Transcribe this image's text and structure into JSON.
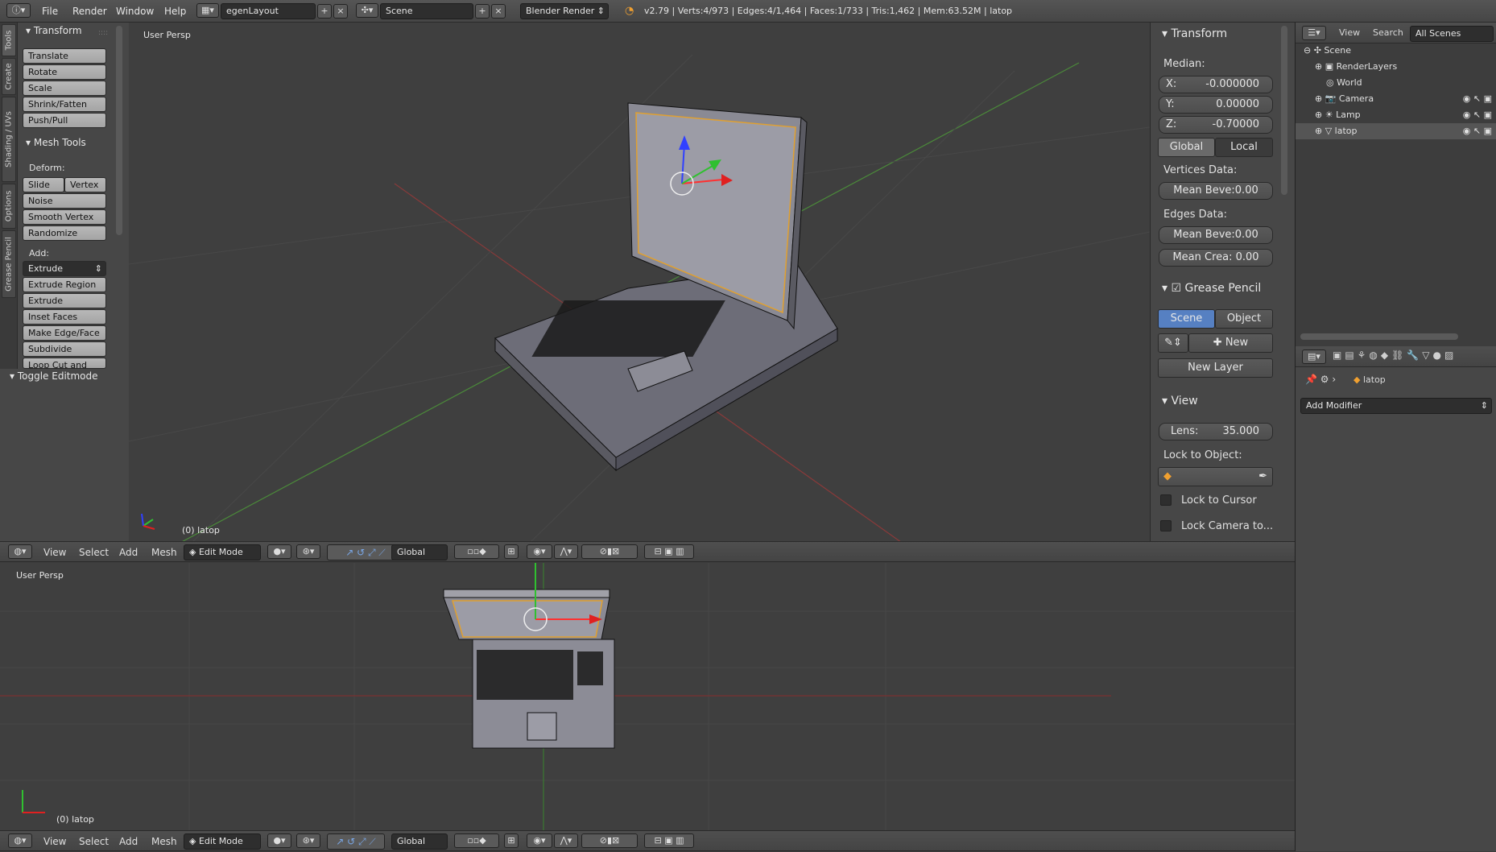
{
  "topbar": {
    "menus": [
      "File",
      "Render",
      "Window",
      "Help"
    ],
    "layout": "egenLayout",
    "scene": "Scene",
    "engine": "Blender Render",
    "stats": "v2.79 | Verts:4/973 | Edges:4/1,464 | Faces:1/733 | Tris:1,462 | Mem:63.52M | latop"
  },
  "tabs": [
    "Tools",
    "Create",
    "Shading / UVs",
    "Options",
    "Grease Pencil"
  ],
  "toolshelf": {
    "transform_header": "Transform",
    "transform_items": [
      "Translate",
      "Rotate",
      "Scale",
      "Shrink/Fatten",
      "Push/Pull"
    ],
    "mesh_header": "Mesh Tools",
    "deform_label": "Deform:",
    "slide_edge": "Slide Ed",
    "vertex": "Vertex",
    "deform_items": [
      "Noise",
      "Smooth Vertex",
      "Randomize"
    ],
    "add_label": "Add:",
    "extrude": "Extrude",
    "add_items": [
      "Extrude Region",
      "Extrude Individual",
      "Inset Faces",
      "Make Edge/Face",
      "Subdivide",
      "Loop Cut and Slide"
    ],
    "toggle_editmode": "Toggle Editmode"
  },
  "viewport_top": {
    "label": "User Persp",
    "object": "(0) latop"
  },
  "npanel": {
    "transform_header": "Transform",
    "median": "Median:",
    "x_label": "X:",
    "x_value": "-0.000000",
    "y_label": "Y:",
    "y_value": "0.00000",
    "z_label": "Z:",
    "z_value": "-0.70000",
    "global": "Global",
    "local": "Local",
    "vertices_data": "Vertices Data:",
    "mean_bevel_v": "Mean Beve:0.00",
    "edges_data": "Edges Data:",
    "mean_bevel_e": "Mean Beve:0.00",
    "mean_crease": "Mean Crea: 0.00",
    "grease_header": "Grease Pencil",
    "scene_btn": "Scene",
    "object_btn": "Object",
    "new_btn": "New",
    "new_layer": "New Layer",
    "view_header": "View",
    "lens": "Lens:",
    "lens_value": "35.000",
    "lock_to_object": "Lock to Object:",
    "lock_cursor": "Lock to Cursor",
    "lock_camera": "Lock Camera to..."
  },
  "view_header": {
    "items": [
      "View",
      "Select",
      "Add",
      "Mesh"
    ],
    "mode": "Edit Mode",
    "orientation": "Global"
  },
  "viewport_bottom": {
    "label": "User Persp",
    "object": "(0) latop"
  },
  "outliner": {
    "view": "View",
    "search": "Search",
    "filter": "All Scenes",
    "items": [
      "Scene",
      "RenderLayers",
      "World",
      "Camera",
      "Lamp",
      "latop"
    ]
  },
  "properties": {
    "object": "latop",
    "add_modifier": "Add Modifier"
  },
  "colors": {
    "accent": "#5680c2",
    "selected": "#f0a030"
  }
}
